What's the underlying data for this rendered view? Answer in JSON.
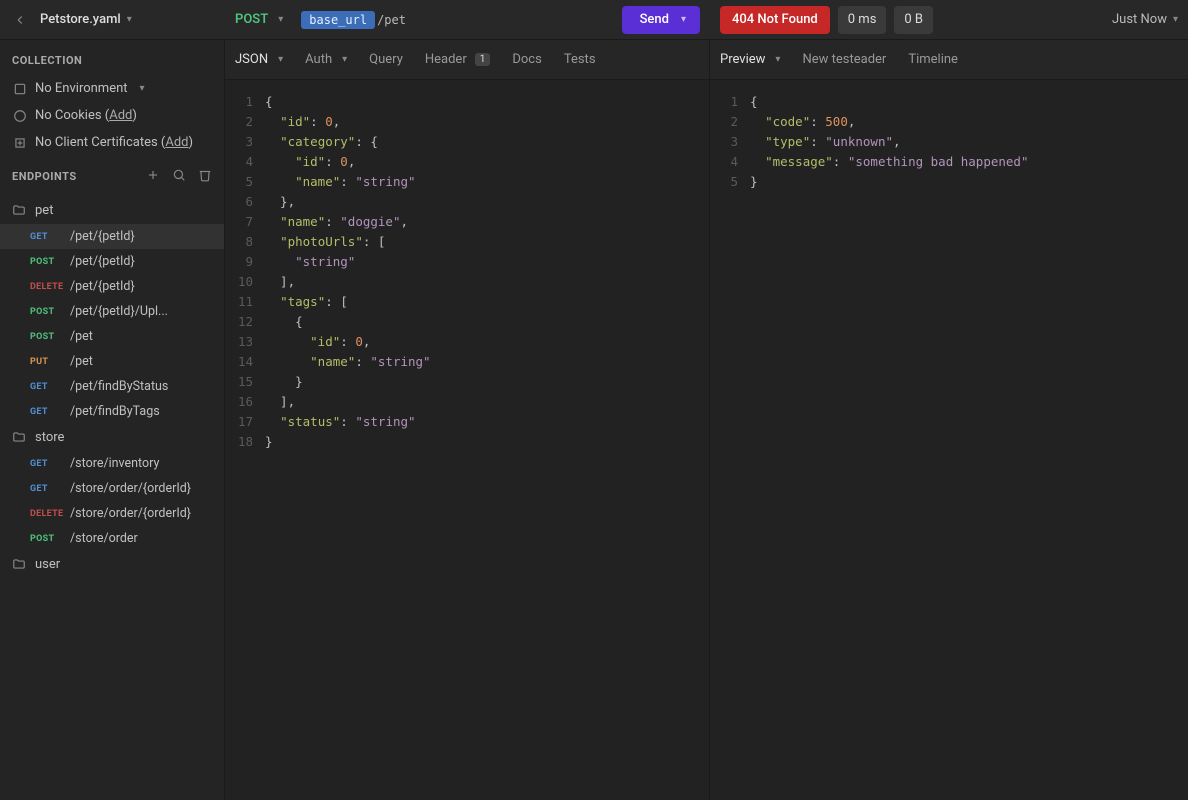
{
  "topbar": {
    "project_title": "Petstore.yaml",
    "method": "POST",
    "url_var": "base_url",
    "url_path": "/pet",
    "send_label": "Send",
    "status_label": "404 Not Found",
    "time_label": "0 ms",
    "size_label": "0 B",
    "when_label": "Just Now"
  },
  "collection": {
    "header": "COLLECTION",
    "env_label": "No Environment",
    "cookies_label": "No Cookies (",
    "cookies_add": "Add",
    "certs_label": "No Client Certificates (",
    "certs_add": "Add"
  },
  "endpoints": {
    "header": "ENDPOINTS",
    "folders": [
      {
        "name": "pet",
        "items": [
          {
            "method": "GET",
            "path": "/pet/{petId}",
            "selected": true
          },
          {
            "method": "POST",
            "path": "/pet/{petId}"
          },
          {
            "method": "DELETE",
            "path": "/pet/{petId}"
          },
          {
            "method": "POST",
            "path": "/pet/{petId}/Upl..."
          },
          {
            "method": "POST",
            "path": "/pet"
          },
          {
            "method": "PUT",
            "path": "/pet"
          },
          {
            "method": "GET",
            "path": "/pet/findByStatus"
          },
          {
            "method": "GET",
            "path": "/pet/findByTags"
          }
        ]
      },
      {
        "name": "store",
        "items": [
          {
            "method": "GET",
            "path": "/store/inventory"
          },
          {
            "method": "GET",
            "path": "/store/order/{orderId}"
          },
          {
            "method": "DELETE",
            "path": "/store/order/{orderId}"
          },
          {
            "method": "POST",
            "path": "/store/order"
          }
        ]
      },
      {
        "name": "user",
        "items": []
      }
    ]
  },
  "request_tabs": {
    "json": "JSON",
    "auth": "Auth",
    "query": "Query",
    "header": "Header",
    "header_count": "1",
    "docs": "Docs",
    "tests": "Tests"
  },
  "response_tabs": {
    "preview": "Preview",
    "new_testeader": "New testeader",
    "timeline": "Timeline"
  },
  "request_body": [
    [
      [
        "punc",
        "{"
      ]
    ],
    [
      [
        "punc",
        "  "
      ],
      [
        "key",
        "\"id\""
      ],
      [
        "punc",
        ": "
      ],
      [
        "num",
        "0"
      ],
      [
        "punc",
        ","
      ]
    ],
    [
      [
        "punc",
        "  "
      ],
      [
        "key",
        "\"category\""
      ],
      [
        "punc",
        ": {"
      ]
    ],
    [
      [
        "punc",
        "    "
      ],
      [
        "key",
        "\"id\""
      ],
      [
        "punc",
        ": "
      ],
      [
        "num",
        "0"
      ],
      [
        "punc",
        ","
      ]
    ],
    [
      [
        "punc",
        "    "
      ],
      [
        "key",
        "\"name\""
      ],
      [
        "punc",
        ": "
      ],
      [
        "str",
        "\"string\""
      ]
    ],
    [
      [
        "punc",
        "  },"
      ]
    ],
    [
      [
        "punc",
        "  "
      ],
      [
        "key",
        "\"name\""
      ],
      [
        "punc",
        ": "
      ],
      [
        "str",
        "\"doggie\""
      ],
      [
        "punc",
        ","
      ]
    ],
    [
      [
        "punc",
        "  "
      ],
      [
        "key",
        "\"photoUrls\""
      ],
      [
        "punc",
        ": ["
      ]
    ],
    [
      [
        "punc",
        "    "
      ],
      [
        "str",
        "\"string\""
      ]
    ],
    [
      [
        "punc",
        "  ],"
      ]
    ],
    [
      [
        "punc",
        "  "
      ],
      [
        "key",
        "\"tags\""
      ],
      [
        "punc",
        ": ["
      ]
    ],
    [
      [
        "punc",
        "    {"
      ]
    ],
    [
      [
        "punc",
        "      "
      ],
      [
        "key",
        "\"id\""
      ],
      [
        "punc",
        ": "
      ],
      [
        "num",
        "0"
      ],
      [
        "punc",
        ","
      ]
    ],
    [
      [
        "punc",
        "      "
      ],
      [
        "key",
        "\"name\""
      ],
      [
        "punc",
        ": "
      ],
      [
        "str",
        "\"string\""
      ]
    ],
    [
      [
        "punc",
        "    }"
      ]
    ],
    [
      [
        "punc",
        "  ],"
      ]
    ],
    [
      [
        "punc",
        "  "
      ],
      [
        "key",
        "\"status\""
      ],
      [
        "punc",
        ": "
      ],
      [
        "str",
        "\"string\""
      ]
    ],
    [
      [
        "punc",
        "}"
      ]
    ]
  ],
  "response_body": [
    [
      [
        "punc",
        "{"
      ]
    ],
    [
      [
        "punc",
        "  "
      ],
      [
        "key",
        "\"code\""
      ],
      [
        "punc",
        ": "
      ],
      [
        "num",
        "500"
      ],
      [
        "punc",
        ","
      ]
    ],
    [
      [
        "punc",
        "  "
      ],
      [
        "key",
        "\"type\""
      ],
      [
        "punc",
        ": "
      ],
      [
        "str",
        "\"unknown\""
      ],
      [
        "punc",
        ","
      ]
    ],
    [
      [
        "punc",
        "  "
      ],
      [
        "key",
        "\"message\""
      ],
      [
        "punc",
        ": "
      ],
      [
        "str",
        "\"something bad happened\""
      ]
    ],
    [
      [
        "punc",
        "}"
      ]
    ]
  ]
}
